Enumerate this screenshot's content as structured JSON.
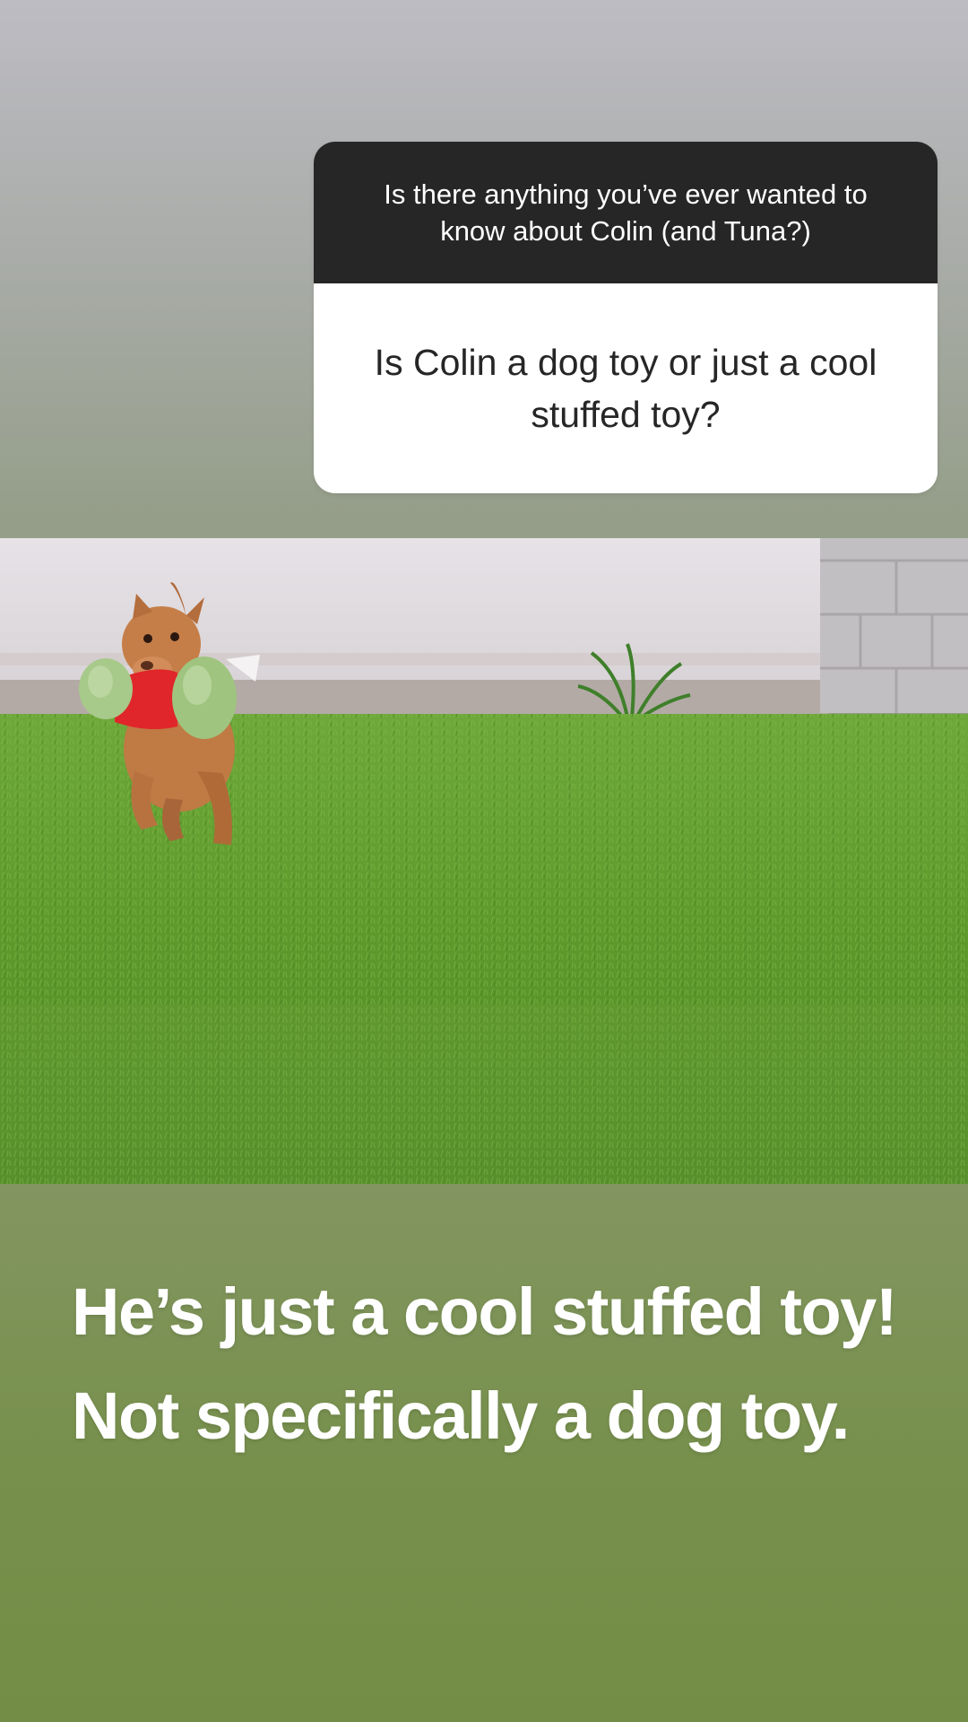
{
  "question_sticker": {
    "prompt": "Is there anything you’ve ever wanted to know about Colin (and Tuna?)",
    "answer": "Is Colin a dog toy or just a cool stuffed toy?",
    "header_color": "#262626",
    "body_color": "#ffffff"
  },
  "photo": {
    "subject": "dog running on grass carrying green stuffed toy"
  },
  "caption": {
    "text": "He’s just a cool stuffed toy! Not specifically a dog toy.",
    "color": "#ffffff"
  },
  "colors": {
    "background_top": "#bdbcc3",
    "background_bottom": "#738d46",
    "grass": "#5e9a2e",
    "wall": "#e2dee3"
  }
}
